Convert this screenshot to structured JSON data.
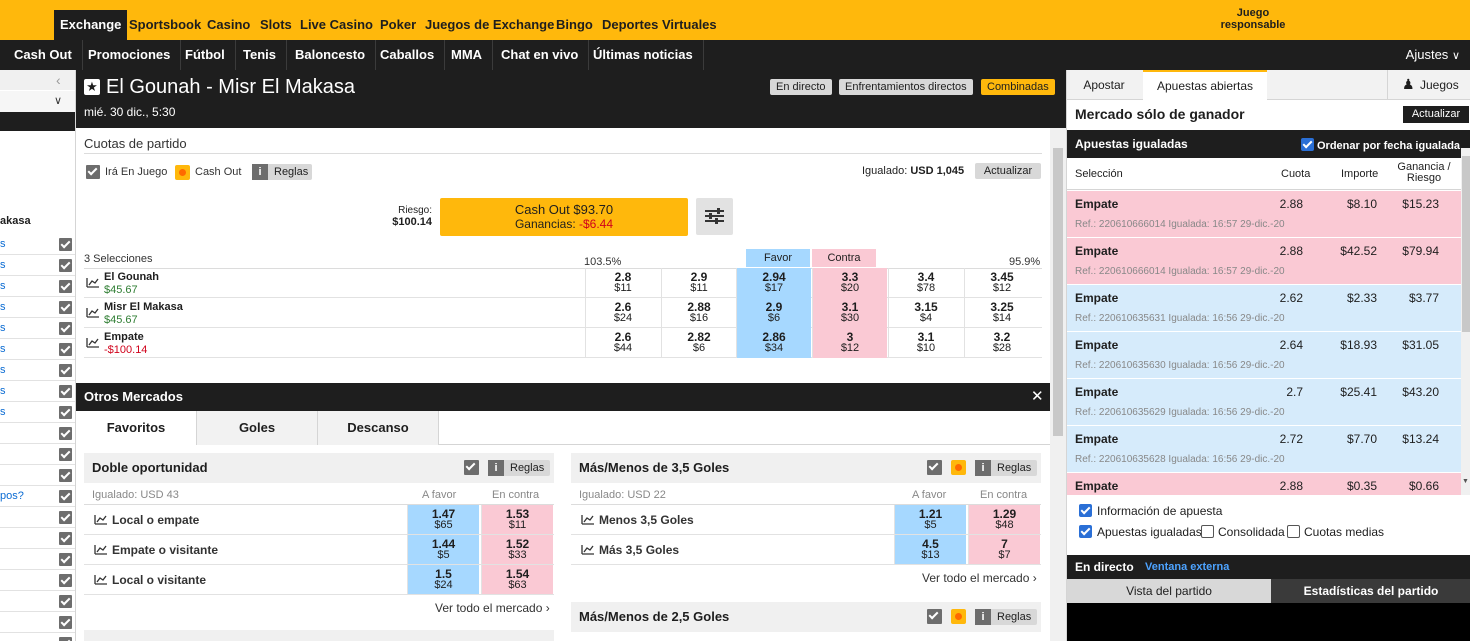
{
  "topnav": {
    "tabs": [
      "Exchange",
      "Sportsbook",
      "Casino",
      "Slots",
      "Live Casino",
      "Poker",
      "Juegos de Exchange",
      "Bingo",
      "Deportes Virtuales"
    ],
    "responsible_line1": "Juego",
    "responsible_line2": "responsable"
  },
  "subnav": {
    "items": [
      "Cash Out",
      "Promociones",
      "Fútbol",
      "Tenis",
      "Baloncesto",
      "Caballos",
      "MMA",
      "Chat en vivo",
      "Últimas noticias"
    ],
    "settings": "Ajustes"
  },
  "leftbar": {
    "label_partial": "akasa",
    "links": [
      "s",
      "s",
      "s",
      "s",
      "s",
      "s",
      "s",
      "s",
      "s"
    ],
    "question": "pos?"
  },
  "event": {
    "title": "El Gounah - Misr El Makasa",
    "date": "mié. 30 dic., 5:30",
    "btn_live": "En directo",
    "btn_h2h": "Enfrentamientos directos",
    "btn_combos": "Combinadas"
  },
  "match_odds": {
    "section_title": "Cuotas de partido",
    "inplay_label": "Irá En Juego",
    "cashout_label": "Cash Out",
    "rules_label": "Reglas",
    "matched_label": "Igualado:",
    "matched_value": "USD 1,045",
    "refresh": "Actualizar",
    "risk_label": "Riesgo:",
    "risk_value": "$100.14",
    "cashout_amount": "Cash Out $93.70",
    "profit_label": "Ganancias:",
    "profit_value": "-$6.44",
    "selections_count": "3 Selecciones",
    "back_overround": "103.5%",
    "lay_overround": "95.9%",
    "back_header": "Favor",
    "lay_header": "Contra",
    "runners": [
      {
        "name": "El Gounah",
        "pnl": "$45.67",
        "pnl_color": "#2e7d32",
        "odds": [
          [
            "2.8",
            "$11"
          ],
          [
            "2.9",
            "$11"
          ],
          [
            "2.94",
            "$17"
          ],
          [
            "3.3",
            "$20"
          ],
          [
            "3.4",
            "$78"
          ],
          [
            "3.45",
            "$12"
          ]
        ]
      },
      {
        "name": "Misr El Makasa",
        "pnl": "$45.67",
        "pnl_color": "#2e7d32",
        "odds": [
          [
            "2.6",
            "$24"
          ],
          [
            "2.88",
            "$16"
          ],
          [
            "2.9",
            "$6"
          ],
          [
            "3.1",
            "$30"
          ],
          [
            "3.15",
            "$4"
          ],
          [
            "3.25",
            "$14"
          ]
        ]
      },
      {
        "name": "Empate",
        "pnl": "-$100.14",
        "pnl_color": "#d0021b",
        "odds": [
          [
            "2.6",
            "$44"
          ],
          [
            "2.82",
            "$6"
          ],
          [
            "2.86",
            "$34"
          ],
          [
            "3",
            "$12"
          ],
          [
            "3.1",
            "$10"
          ],
          [
            "3.2",
            "$28"
          ]
        ]
      }
    ]
  },
  "other_markets": {
    "title": "Otros Mercados",
    "tabs": [
      "Favoritos",
      "Goles",
      "Descanso"
    ],
    "markets": [
      {
        "title": "Doble oportunidad",
        "matched": "Igualado: USD 43",
        "back": "A favor",
        "lay": "En contra",
        "rules": "Reglas",
        "see_all": "Ver todo el mercado",
        "rows": [
          [
            "Local o empate",
            "1.47",
            "$65",
            "1.53",
            "$11"
          ],
          [
            "Empate o visitante",
            "1.44",
            "$5",
            "1.52",
            "$33"
          ],
          [
            "Local o visitante",
            "1.5",
            "$24",
            "1.54",
            "$63"
          ]
        ]
      },
      {
        "title": "Más/Menos de 3,5 Goles",
        "matched": "Igualado: USD 22",
        "back": "A favor",
        "lay": "En contra",
        "rules": "Reglas",
        "see_all": "Ver todo el mercado",
        "rows": [
          [
            "Menos 3,5 Goles",
            "1.21",
            "$5",
            "1.29",
            "$48"
          ],
          [
            "Más 3,5 Goles",
            "4.5",
            "$13",
            "7",
            "$7"
          ]
        ]
      },
      {
        "title": "Más/Menos de 2,5 Goles",
        "rules": "Reglas"
      }
    ]
  },
  "betslip": {
    "tab_place": "Apostar",
    "tab_open": "Apuestas abiertas",
    "games": "Juegos",
    "market_title": "Mercado sólo de ganador",
    "refresh": "Actualizar",
    "matched_title": "Apuestas igualadas",
    "sort_label": "Ordenar por fecha igualada",
    "col_selection": "Selección",
    "col_odds": "Cuota",
    "col_stake": "Importe",
    "col_profit_1": "Ganancia /",
    "col_profit_2": "Riesgo",
    "bets": [
      {
        "sel": "Empate",
        "odds": "2.88",
        "stake": "$8.10",
        "profit": "$15.23",
        "ref": "Ref.: 220610666014   Igualada: 16:57 29-dic.-20",
        "type": "lay"
      },
      {
        "sel": "Empate",
        "odds": "2.88",
        "stake": "$42.52",
        "profit": "$79.94",
        "ref": "Ref.: 220610666014   Igualada: 16:57 29-dic.-20",
        "type": "lay"
      },
      {
        "sel": "Empate",
        "odds": "2.62",
        "stake": "$2.33",
        "profit": "$3.77",
        "ref": "Ref.: 220610635631   Igualada: 16:56 29-dic.-20",
        "type": "back"
      },
      {
        "sel": "Empate",
        "odds": "2.64",
        "stake": "$18.93",
        "profit": "$31.05",
        "ref": "Ref.: 220610635630   Igualada: 16:56 29-dic.-20",
        "type": "back"
      },
      {
        "sel": "Empate",
        "odds": "2.7",
        "stake": "$25.41",
        "profit": "$43.20",
        "ref": "Ref.: 220610635629   Igualada: 16:56 29-dic.-20",
        "type": "back"
      },
      {
        "sel": "Empate",
        "odds": "2.72",
        "stake": "$7.70",
        "profit": "$13.24",
        "ref": "Ref.: 220610635628   Igualada: 16:56 29-dic.-20",
        "type": "back"
      },
      {
        "sel": "Empate",
        "odds": "2.88",
        "stake": "$0.35",
        "profit": "$0.66",
        "ref": "",
        "type": "lay"
      }
    ],
    "opt_info": "Información de apuesta",
    "opt_matched": "Apuestas igualadas",
    "opt_consolidated": "Consolidada",
    "opt_avg": "Cuotas medias",
    "live_title": "En directo",
    "live_external": "Ventana externa",
    "tab_match_view": "Vista del partido",
    "tab_stats": "Estadísticas del partido"
  },
  "colors": {
    "brand": "#ffb80c",
    "dark": "#1e1e1e",
    "back": "#a6d8ff",
    "lay": "#fac9d4",
    "link": "#0a6bd3"
  }
}
